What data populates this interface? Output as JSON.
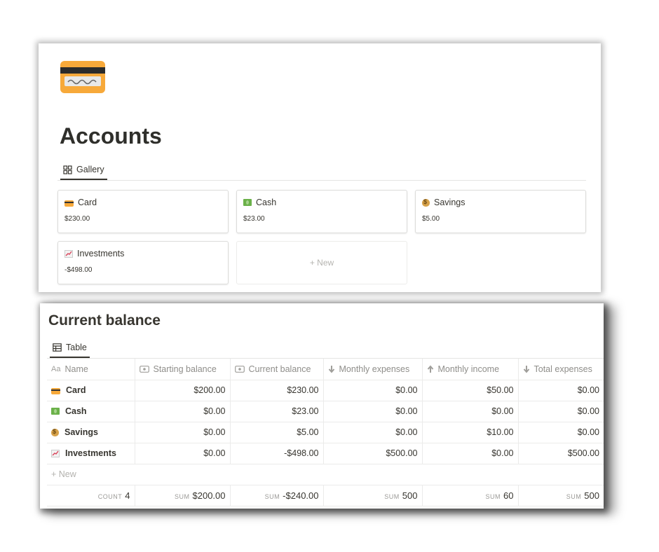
{
  "accounts": {
    "title": "Accounts",
    "view_tab": "Gallery",
    "cards": [
      {
        "name": "Card",
        "icon": "credit-card-emoji",
        "value": "$230.00"
      },
      {
        "name": "Cash",
        "icon": "dollar-banknote-emoji",
        "value": "$23.00"
      },
      {
        "name": "Savings",
        "icon": "money-bag-emoji",
        "value": "$5.00"
      },
      {
        "name": "Investments",
        "icon": "chart-increasing-emoji",
        "value": "-$498.00"
      }
    ],
    "new_label": "+ New",
    "icon_color": "#f7a93a"
  },
  "balance": {
    "title": "Current balance",
    "view_tab": "Table",
    "columns": [
      {
        "label": "Name",
        "icon": "Aa"
      },
      {
        "label": "Starting balance",
        "icon": "money-icon"
      },
      {
        "label": "Current balance",
        "icon": "money-icon"
      },
      {
        "label": "Monthly expenses",
        "icon": "arrow-down-icon"
      },
      {
        "label": "Monthly income",
        "icon": "arrow-up-icon"
      },
      {
        "label": "Total expenses",
        "icon": "arrow-down-icon"
      }
    ],
    "rows": [
      {
        "name": "Card",
        "starting": "$200.00",
        "current": "$230.00",
        "monthly_expenses": "$0.00",
        "monthly_income": "$50.00",
        "total_expenses": "$0.00"
      },
      {
        "name": "Cash",
        "starting": "$0.00",
        "current": "$23.00",
        "monthly_expenses": "$0.00",
        "monthly_income": "$0.00",
        "total_expenses": "$0.00"
      },
      {
        "name": "Savings",
        "starting": "$0.00",
        "current": "$5.00",
        "monthly_expenses": "$0.00",
        "monthly_income": "$10.00",
        "total_expenses": "$0.00"
      },
      {
        "name": "Investments",
        "starting": "$0.00",
        "current": "-$498.00",
        "monthly_expenses": "$500.00",
        "monthly_income": "$0.00",
        "total_expenses": "$500.00"
      }
    ],
    "new_label": "+ New",
    "summary": {
      "count_label": "COUNT",
      "count": "4",
      "sum_label": "SUM",
      "starting": "$200.00",
      "current": "-$240.00",
      "monthly_expenses": "500",
      "monthly_income": "60",
      "total_expenses": "500"
    }
  }
}
